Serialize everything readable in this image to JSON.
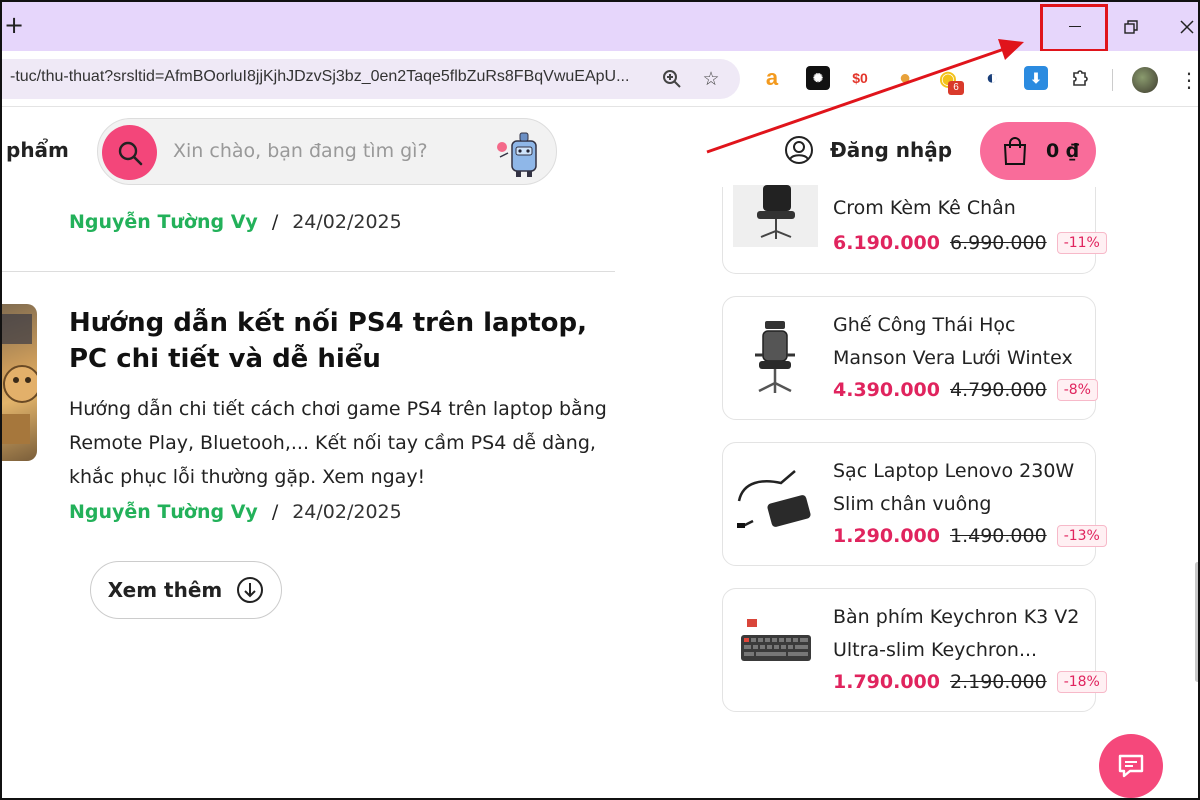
{
  "browser": {
    "new_tab_label": "+",
    "url": "-tuc/thu-thuat?srsltid=AfmBOorluI8jjKjhJDzvSj3bz_0en2Taqe5flbZuRs8FBqVwuEApU...",
    "extension_badge": "6",
    "window_controls": [
      "minimize",
      "restore",
      "close"
    ],
    "highlight_color": "#e0141b"
  },
  "header": {
    "brand_partial": "phẩm",
    "search_placeholder": "Xin chào, bạn đang tìm gì?",
    "login_label": "Đăng nhập",
    "cart_total": "0 ₫",
    "accent": "#f3467a"
  },
  "articles": [
    {
      "author": "Nguyễn Tường Vy",
      "date": "24/02/2025"
    },
    {
      "title": "Hướng dẫn kết nối PS4 trên laptop, PC chi tiết và dễ hiểu",
      "description": "Hướng dẫn chi tiết cách chơi game PS4 trên laptop bằng Remote Play, Bluetooh,... Kết nối tay cầm PS4 dễ dàng, khắc phục lỗi thường gặp. Xem ngay!",
      "author": "Nguyễn Tường Vy",
      "date": "24/02/2025"
    }
  ],
  "separator": "/",
  "load_more_label": "Xem thêm",
  "products": [
    {
      "name": "Crom Kèm Kê Chân",
      "price": "6.190.000",
      "old_price": "6.990.000",
      "discount": "-11%"
    },
    {
      "name": "Ghế Công Thái Học Manson Vera Lưới Wintex",
      "price": "4.390.000",
      "old_price": "4.790.000",
      "discount": "-8%"
    },
    {
      "name": "Sạc Laptop Lenovo 230W Slim chân vuông",
      "price": "1.290.000",
      "old_price": "1.490.000",
      "discount": "-13%"
    },
    {
      "name": "Bàn phím Keychron K3 V2 Ultra-slim Keychron...",
      "price": "1.790.000",
      "old_price": "2.190.000",
      "discount": "-18%"
    }
  ]
}
